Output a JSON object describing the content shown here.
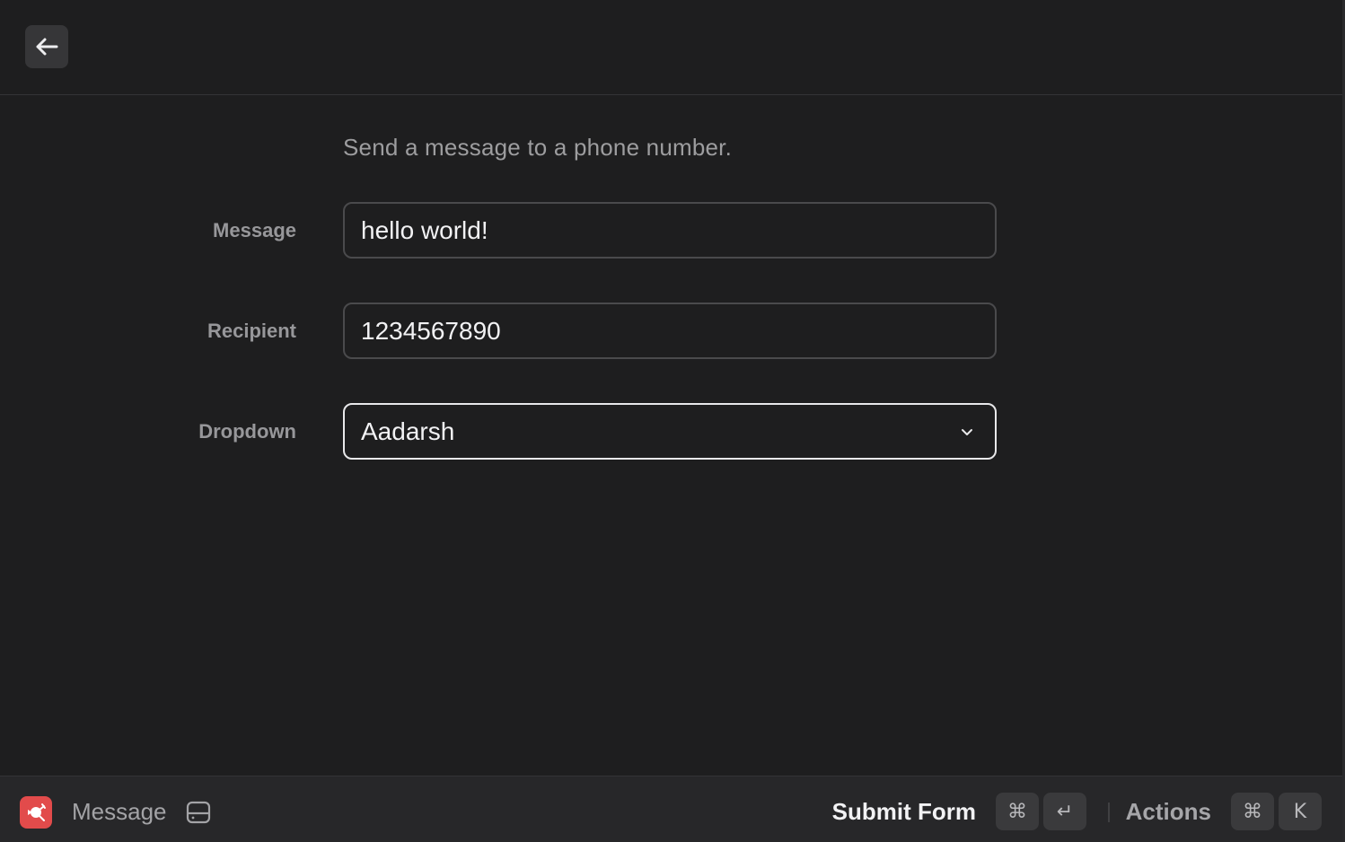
{
  "header": {
    "back_icon": "arrow-left-icon"
  },
  "form": {
    "description": "Send a message to a phone number.",
    "fields": [
      {
        "label": "Message",
        "value": "hello world!"
      },
      {
        "label": "Recipient",
        "value": "1234567890"
      },
      {
        "label": "Dropdown",
        "value": "Aadarsh"
      }
    ]
  },
  "footer": {
    "app_icon": "app-icon",
    "title": "Message",
    "drive_icon": "drive-icon",
    "primary_action": "Submit Form",
    "primary_shortcut": [
      "⌘",
      "↵"
    ],
    "secondary_action": "Actions",
    "secondary_shortcut": [
      "⌘",
      "K"
    ]
  },
  "colors": {
    "background": "#1e1e1f",
    "footer_background": "#272729",
    "app_icon_accent": "#e24b4b"
  }
}
